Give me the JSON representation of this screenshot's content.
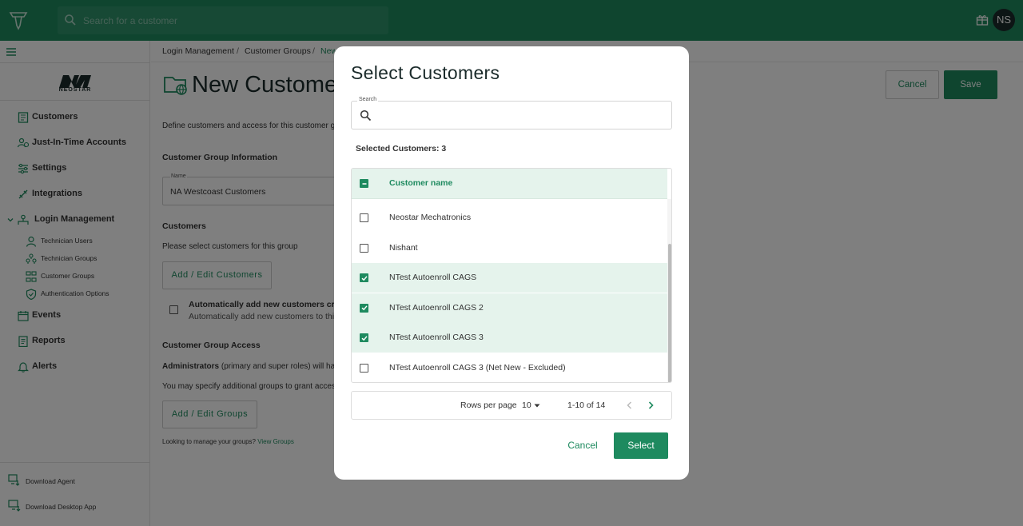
{
  "topbar": {
    "search_placeholder": "Search for a customer",
    "avatar_initials": "NS"
  },
  "sidebar": {
    "brand": "NEOSTAR",
    "items": [
      {
        "label": "Customers",
        "icon": "customers-icon"
      },
      {
        "label": "Just-In-Time Accounts",
        "icon": "jit-accounts-icon"
      },
      {
        "label": "Settings",
        "icon": "settings-icon"
      },
      {
        "label": "Integrations",
        "icon": "integrations-icon"
      },
      {
        "label": "Login Management",
        "icon": "login-management-icon"
      },
      {
        "label": "Events",
        "icon": "events-icon"
      },
      {
        "label": "Reports",
        "icon": "reports-icon"
      },
      {
        "label": "Alerts",
        "icon": "alerts-icon"
      }
    ],
    "sub_items": [
      {
        "label": "Technician Users",
        "icon": "technician-users-icon"
      },
      {
        "label": "Technician Groups",
        "icon": "technician-groups-icon"
      },
      {
        "label": "Customer Groups",
        "icon": "customer-groups-icon"
      },
      {
        "label": "Authentication Options",
        "icon": "shield-icon"
      }
    ],
    "downloads": [
      {
        "label": "Download Agent",
        "icon": "download-agent-icon"
      },
      {
        "label": "Download Desktop App",
        "icon": "download-desktop-icon"
      }
    ]
  },
  "breadcrumb": {
    "items": [
      "Login Management",
      "Customer Groups",
      "New"
    ]
  },
  "page": {
    "title": "New Customer",
    "cancel_label": "Cancel",
    "save_label": "Save",
    "description": "Define customers and access for this customer g",
    "info_heading": "Customer Group Information",
    "name_label": "Name",
    "name_value": "NA Westcoast Customers",
    "customers_heading": "Customers",
    "customers_hint": "Please select customers for this group",
    "add_customers_label": "Add / Edit Customers",
    "auto_add_title": "Automatically add new customers creat",
    "auto_add_desc": "Automatically add new customers to this",
    "access_heading": "Customer Group Access",
    "admins_bold": "Administrators",
    "admins_text": " (primary and super roles) will ha",
    "additional_text": "You may specify additional groups to grant acces",
    "add_groups_label": "Add / Edit Groups",
    "manage_text": "Looking to manage your groups? ",
    "view_groups_link": "View Groups"
  },
  "modal": {
    "title": "Select Customers",
    "search_label": "Search",
    "search_value": "",
    "selected_text": "Selected Customers: 3",
    "column_header": "Customer name",
    "rows": [
      {
        "name": "Neostar Mechatronics",
        "checked": false
      },
      {
        "name": "Nishant",
        "checked": false
      },
      {
        "name": "NTest Autoenroll CAGS",
        "checked": true
      },
      {
        "name": "NTest Autoenroll CAGS 2",
        "checked": true
      },
      {
        "name": "NTest Autoenroll CAGS 3",
        "checked": true
      },
      {
        "name": "NTest Autoenroll CAGS 3 (Net New - Excluded)",
        "checked": false
      }
    ],
    "rows_per_page_label": "Rows per page",
    "rows_per_page_value": "10",
    "range_text": "1-10 of 14",
    "cancel_label": "Cancel",
    "select_label": "Select"
  },
  "colors": {
    "brand_green": "#1e8a5f",
    "selected_row": "#e5f3ec",
    "overlay": "rgba(0,0,0,0.5)"
  }
}
